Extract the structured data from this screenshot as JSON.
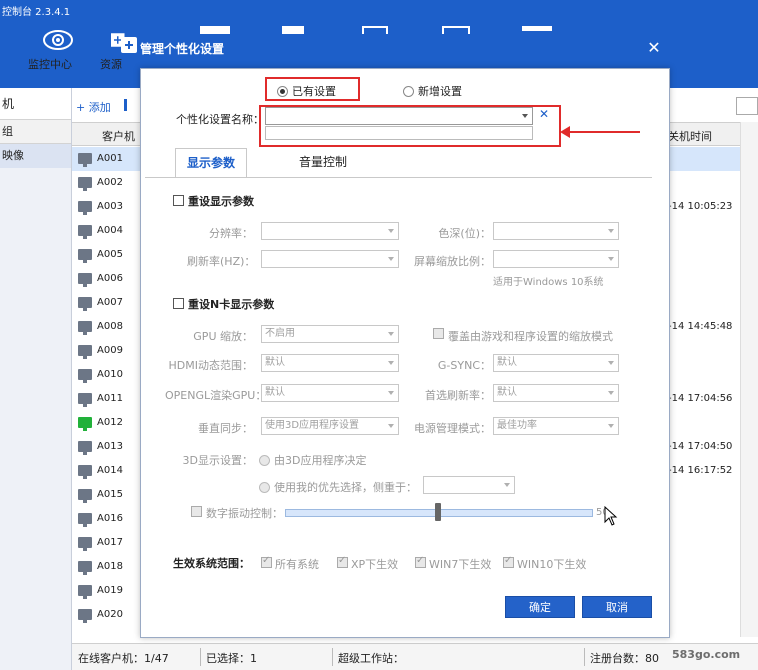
{
  "app": {
    "title": "控制台 2.3.4.1"
  },
  "toolbar": {
    "items": [
      {
        "label": "监控中心",
        "icon": "eye-icon"
      },
      {
        "label": "资源",
        "icon": "add-resource-icon"
      }
    ]
  },
  "left_panel": {
    "header": "机",
    "group_label": "组",
    "selected_group": "映像"
  },
  "list_toolbar": {
    "add_label": "+ 添加"
  },
  "list": {
    "col_name": "客户机",
    "col_time": "关机时间",
    "rows": [
      {
        "name": "A001",
        "time": "",
        "online": false,
        "selected": true
      },
      {
        "name": "A002",
        "time": "",
        "online": false
      },
      {
        "name": "A003",
        "time": "-14 10:05:23",
        "online": false
      },
      {
        "name": "A004",
        "time": "",
        "online": false
      },
      {
        "name": "A005",
        "time": "",
        "online": false
      },
      {
        "name": "A006",
        "time": "",
        "online": false
      },
      {
        "name": "A007",
        "time": "",
        "online": false
      },
      {
        "name": "A008",
        "time": "-14 14:45:48",
        "online": false
      },
      {
        "name": "A009",
        "time": "",
        "online": false
      },
      {
        "name": "A010",
        "time": "",
        "online": false
      },
      {
        "name": "A011",
        "time": "-14 17:04:56",
        "online": false
      },
      {
        "name": "A012",
        "time": "",
        "online": true
      },
      {
        "name": "A013",
        "time": "-14 17:04:50",
        "online": false
      },
      {
        "name": "A014",
        "time": "-14 16:17:52",
        "online": false
      },
      {
        "name": "A015",
        "time": "",
        "online": false
      },
      {
        "name": "A016",
        "time": "",
        "online": false
      },
      {
        "name": "A017",
        "time": "",
        "online": false
      },
      {
        "name": "A018",
        "time": "",
        "online": false
      },
      {
        "name": "A019",
        "time": "",
        "online": false
      },
      {
        "name": "A020",
        "time": "",
        "online": false
      }
    ]
  },
  "statusbar": {
    "online": "在线客户机：1/47",
    "selected": "已选择：1",
    "super_ws": "超级工作站：",
    "registered": "注册台数：80"
  },
  "dialog": {
    "title": "管理个性化设置",
    "radio_existing": "已有设置",
    "radio_new": "新增设置",
    "name_label": "个性化设置名称：",
    "name_value": "",
    "tabs": [
      "显示参数",
      "音量控制"
    ],
    "reset_display": "重设显示参数",
    "resolution_label": "分辨率：",
    "color_label": "色深(位)：",
    "refresh_label": "刷新率(HZ)：",
    "scale_label": "屏幕缩放比例：",
    "win10_note": "适用于Windows 10系统",
    "reset_nvidia": "重设N卡显示参数",
    "gpu_scale_label": "GPU 缩放：",
    "gpu_scale_value": "不启用",
    "override_label": "覆盖由游戏和程序设置的缩放模式",
    "hdmi_label": "HDMI动态范围：",
    "hdmi_value": "默认",
    "gsync_label": "G-SYNC：",
    "gsync_value": "默认",
    "opengl_label": "OPENGL渲染GPU：",
    "opengl_value": "默认",
    "pref_refresh_label": "首选刷新率：",
    "pref_refresh_value": "默认",
    "vsync_label": "垂直同步：",
    "vsync_value": "使用3D应用程序设置",
    "power_label": "电源管理模式：",
    "power_value": "最佳功率",
    "d3_label": "3D显示设置：",
    "d3_opt1": "由3D应用程序决定",
    "d3_opt2": "使用我的优先选择，侧重于：",
    "vibrance_label": "数字振动控制：",
    "vibrance_value": "50",
    "scope_label": "生效系统范围：",
    "scope_all": "所有系统",
    "scope_xp": "XP下生效",
    "scope_win7": "WIN7下生效",
    "scope_win10": "WIN10下生效",
    "ok_label": "确定",
    "cancel_label": "取消"
  },
  "watermark": "583go.com",
  "colors": {
    "header_blue": "#1d5fc9",
    "highlight_red": "#e02b2b",
    "button_blue": "#2462c9",
    "online_green": "#21b13a"
  }
}
